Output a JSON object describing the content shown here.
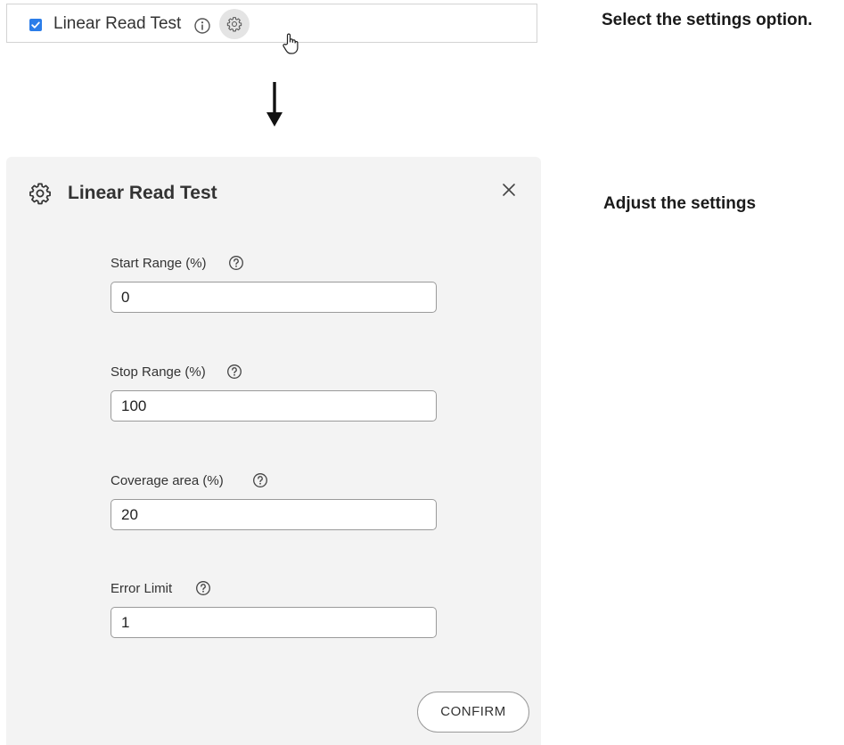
{
  "step1": {
    "item_label": "Linear Read Test",
    "checked": true,
    "instruction": "Select the settings option."
  },
  "step2": {
    "instruction": "Adjust the settings",
    "dialog": {
      "title": "Linear Read Test",
      "fields": [
        {
          "label": "Start Range (%)",
          "value": "0"
        },
        {
          "label": "Stop Range (%)",
          "value": "100"
        },
        {
          "label": "Coverage area (%)",
          "value": "20"
        },
        {
          "label": "Error Limit",
          "value": "1"
        }
      ],
      "confirm_label": "CONFIRM"
    }
  },
  "icons": {
    "checkbox": "checkbox-checked-icon",
    "info": "info-icon",
    "settings": "gear-icon",
    "cursor": "hand-pointer-icon",
    "arrow": "arrow-down-icon",
    "close": "close-icon",
    "help": "help-icon"
  },
  "colors": {
    "accent": "#2b7de9",
    "panel_background": "#f3f3f3",
    "gear_button_background": "#e4e4e4"
  }
}
